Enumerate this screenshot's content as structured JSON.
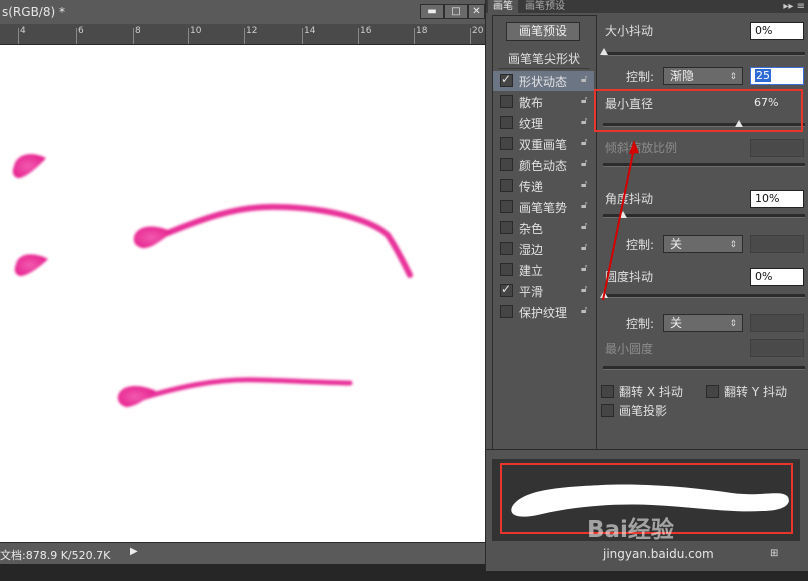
{
  "document": {
    "title": "s(RGB/8) *",
    "ruler_ticks": [
      "4",
      "6",
      "8",
      "10",
      "12",
      "14",
      "16",
      "18",
      "20"
    ],
    "status": "文档:878.9 K/520.7K"
  },
  "panel": {
    "tabs": [
      "画笔",
      "画笔预设"
    ],
    "preset_button": "画笔预设",
    "tip_shape": "画笔笔尖形状",
    "options": [
      {
        "label": "形状动态",
        "checked": true,
        "selected": true
      },
      {
        "label": "散布",
        "checked": false
      },
      {
        "label": "纹理",
        "checked": false
      },
      {
        "label": "双重画笔",
        "checked": false
      },
      {
        "label": "颜色动态",
        "checked": false
      },
      {
        "label": "传递",
        "checked": false
      },
      {
        "label": "画笔笔势",
        "checked": false
      },
      {
        "label": "杂色",
        "checked": false
      },
      {
        "label": "湿边",
        "checked": false
      },
      {
        "label": "建立",
        "checked": false
      },
      {
        "label": "平滑",
        "checked": true
      },
      {
        "label": "保护纹理",
        "checked": false
      }
    ],
    "size_jitter": {
      "label": "大小抖动",
      "value": "0%",
      "level": 0
    },
    "control1": {
      "label": "控制:",
      "select": "渐隐",
      "value": "25"
    },
    "min_diameter": {
      "label": "最小直径",
      "value": "67%",
      "level": 0.67
    },
    "tilt_scale": {
      "label": "倾斜缩放比例"
    },
    "angle_jitter": {
      "label": "角度抖动",
      "value": "10%",
      "level": 0.1
    },
    "control2": {
      "label": "控制:",
      "select": "关"
    },
    "roundness_jitter": {
      "label": "圆度抖动",
      "value": "0%",
      "level": 0
    },
    "control3": {
      "label": "控制:",
      "select": "关"
    },
    "min_roundness": {
      "label": "最小圆度"
    },
    "flip_x": "翻转 X 抖动",
    "flip_y": "翻转 Y 抖动",
    "projection": "画笔投影"
  },
  "watermark": {
    "text": "Bai经验",
    "url": "jingyan.baidu.com"
  },
  "colors": {
    "stroke": "#e8309a",
    "annotation": "#e8362d",
    "arrow": "#d40000"
  }
}
